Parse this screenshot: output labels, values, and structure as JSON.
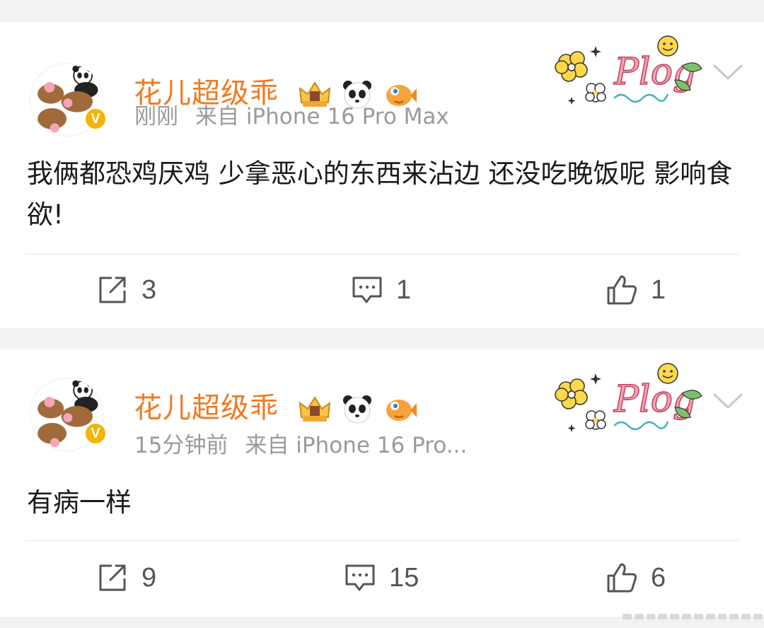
{
  "posts": [
    {
      "username": "花儿超级乖",
      "time": "刚刚",
      "source": "来自 iPhone 16 Pro Max",
      "text": "我俩都恐鸡厌鸡 少拿恶心的东西来沾边 还没吃晚饭呢 影响食欲!",
      "reposts": "3",
      "comments": "1",
      "likes": "1"
    },
    {
      "username": "花儿超级乖",
      "time": "15分钟前",
      "source": "来自 iPhone 16 Pro...",
      "text": "有病一样",
      "reposts": "9",
      "comments": "15",
      "likes": "6"
    }
  ],
  "decoration": {
    "plog_text": "Plog"
  },
  "verified_mark": "V",
  "colors": {
    "username": "#f07a22",
    "meta": "#9a9a9a",
    "text": "#1a1a1a",
    "verified": "#f4b400"
  },
  "icons": [
    "repost-icon",
    "comment-icon",
    "like-icon",
    "chevron-down-icon"
  ]
}
